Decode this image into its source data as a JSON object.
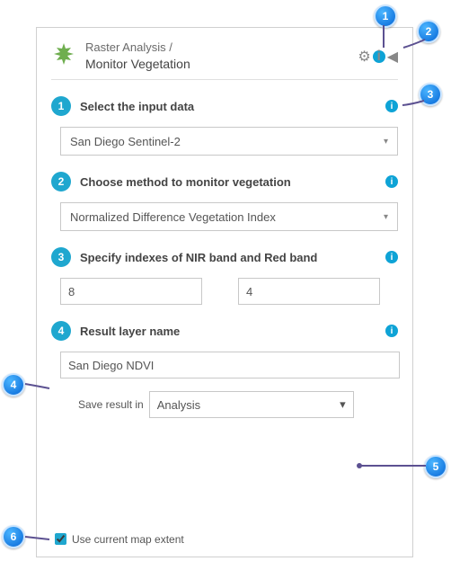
{
  "header": {
    "breadcrumb": "Raster Analysis /",
    "title": "Monitor Vegetation"
  },
  "sections": {
    "s1": {
      "num": "1",
      "label": "Select the input data",
      "value": "San Diego Sentinel-2"
    },
    "s2": {
      "num": "2",
      "label": "Choose method to monitor vegetation",
      "value": "Normalized Difference Vegetation Index"
    },
    "s3": {
      "num": "3",
      "label": "Specify indexes of NIR band and Red band",
      "nir": "8",
      "red": "4"
    },
    "s4": {
      "num": "4",
      "label": "Result layer name",
      "value": "San Diego NDVI",
      "save_label": "Save result in",
      "save_value": "Analysis"
    }
  },
  "footer": {
    "extent_label": "Use current map extent"
  },
  "callouts": {
    "c1": "1",
    "c2": "2",
    "c3": "3",
    "c4": "4",
    "c5": "5",
    "c6": "6"
  }
}
